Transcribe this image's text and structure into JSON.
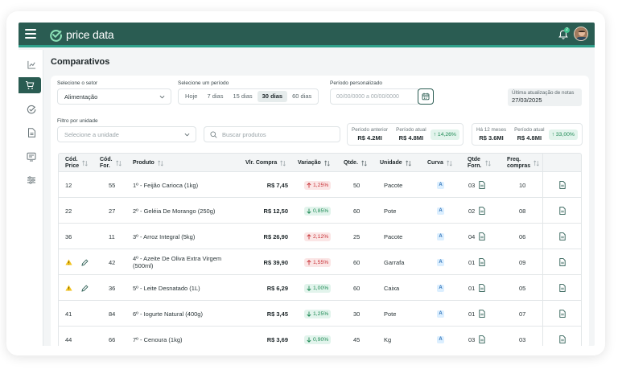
{
  "app": {
    "name": "price data",
    "notification_count": "2"
  },
  "page": {
    "title": "Comparativos"
  },
  "filters": {
    "sector_label": "Selecione o setor",
    "sector_value": "Alimentação",
    "period_label": "Selecione um período",
    "period_options": [
      "Hoje",
      "7 dias",
      "15 dias",
      "30 dias",
      "60 dias"
    ],
    "period_selected": "30 dias",
    "custom_period_label": "Período personalizado",
    "custom_period_placeholder": "00/00/0000 a 00/00/0000",
    "last_update_label": "Última atualização de notas",
    "last_update_value": "27/03/2025",
    "unit_filter_label": "Filtro por unidade",
    "unit_placeholder": "Selecione a unidade",
    "search_placeholder": "Buscar produtos"
  },
  "comparisons": [
    {
      "left_label": "Período anterior",
      "left_value": "R$ 4.2MI",
      "right_label": "Período atual",
      "right_value": "R$ 4.8MI",
      "badge": "14,26%"
    },
    {
      "left_label": "Há 12 meses",
      "left_value": "R$ 3.6MI",
      "right_label": "Período atual",
      "right_value": "R$ 4.8MI",
      "badge": "33,00%"
    }
  ],
  "table": {
    "headers": {
      "cod_price_1": "Cód.",
      "cod_price_2": "Price",
      "cod_for_1": "Cód.",
      "cod_for_2": "For.",
      "produto": "Produto",
      "vlr_compra": "Vlr. Compra",
      "variacao": "Variação",
      "qtde": "Qtde.",
      "unidade": "Unidade",
      "curva": "Curva",
      "qtde_forn_1": "Qtde",
      "qtde_forn_2": "Forn.",
      "freq_1": "Freq.",
      "freq_2": "compras"
    },
    "rows": [
      {
        "warn": false,
        "cod_price": "12",
        "cod_for": "55",
        "produto": "1º - Feijão Carioca (1kg)",
        "vlr": "R$ 7,45",
        "var": "1,25%",
        "dir": "up",
        "qtde": "50",
        "unidade": "Pacote",
        "curva": "A",
        "forn": "03",
        "freq": "10"
      },
      {
        "warn": false,
        "cod_price": "22",
        "cod_for": "27",
        "produto": "2º - Geléia De Morango (250g)",
        "vlr": "R$ 12,50",
        "var": "0,85%",
        "dir": "down",
        "qtde": "60",
        "unidade": "Pote",
        "curva": "A",
        "forn": "02",
        "freq": "08"
      },
      {
        "warn": false,
        "cod_price": "36",
        "cod_for": "11",
        "produto": "3º - Arroz Integral (5kg)",
        "vlr": "R$ 26,90",
        "var": "2,12%",
        "dir": "up",
        "qtde": "25",
        "unidade": "Pacote",
        "curva": "A",
        "forn": "04",
        "freq": "06"
      },
      {
        "warn": true,
        "cod_price": "",
        "cod_for": "42",
        "produto": "4º - Azeite De Oliva Extra Virgem (500ml)",
        "vlr": "R$ 39,90",
        "var": "1,55%",
        "dir": "up",
        "qtde": "60",
        "unidade": "Garrafa",
        "curva": "A",
        "forn": "01",
        "freq": "09"
      },
      {
        "warn": true,
        "cod_price": "",
        "cod_for": "36",
        "produto": "5º - Leite Desnatado (1L)",
        "vlr": "R$ 6,29",
        "var": "1,00%",
        "dir": "down",
        "qtde": "60",
        "unidade": "Caixa",
        "curva": "A",
        "forn": "01",
        "freq": "05"
      },
      {
        "warn": false,
        "cod_price": "41",
        "cod_for": "84",
        "produto": "6º - Iogurte Natural (400g)",
        "vlr": "R$ 3,45",
        "var": "1,25%",
        "dir": "down",
        "qtde": "30",
        "unidade": "Pote",
        "curva": "A",
        "forn": "01",
        "freq": "07"
      },
      {
        "warn": false,
        "cod_price": "44",
        "cod_for": "66",
        "produto": "7º - Cenoura (1kg)",
        "vlr": "R$ 3,69",
        "var": "0,90%",
        "dir": "down",
        "qtde": "45",
        "unidade": "Kg",
        "curva": "A",
        "forn": "03",
        "freq": "03"
      }
    ]
  },
  "colors": {
    "brand": "#2a5c52",
    "accent": "#2fa08a",
    "up": "#c8353a",
    "down": "#1f8a55",
    "warn": "#f2c21b"
  }
}
